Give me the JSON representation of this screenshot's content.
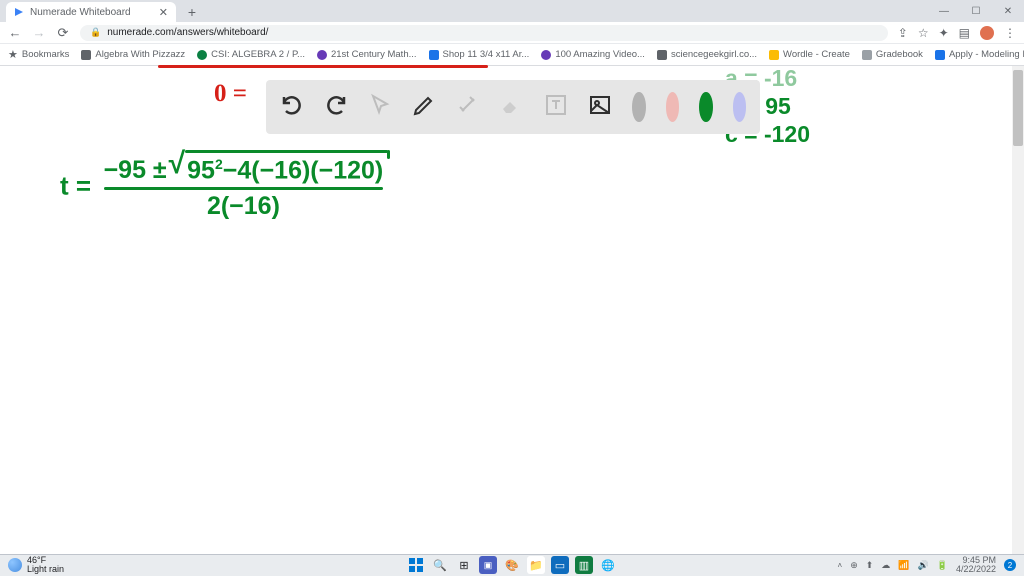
{
  "browser": {
    "tab_title": "Numerade Whiteboard",
    "url": "numerade.com/answers/whiteboard/",
    "win": {
      "min": "—",
      "max": "☐",
      "close": "✕"
    }
  },
  "bookmarks": {
    "label": "Bookmarks",
    "items": [
      {
        "label": "Algebra With Pizzazz",
        "color": "#5f6368"
      },
      {
        "label": "CSI: ALGEBRA 2 / P...",
        "color": "#0b8043"
      },
      {
        "label": "21st Century Math...",
        "color": "#673ab7"
      },
      {
        "label": "Shop 11 3/4 x11 Ar...",
        "color": "#1a73e8"
      },
      {
        "label": "100 Amazing Video...",
        "color": "#673ab7"
      },
      {
        "label": "sciencegeekgirl.co...",
        "color": "#5f6368"
      },
      {
        "label": "Wordle - Create",
        "color": "#fbbc04"
      },
      {
        "label": "Gradebook",
        "color": "#9aa0a6"
      },
      {
        "label": "Apply - Modeling I...",
        "color": "#1a73e8"
      }
    ]
  },
  "whiteboard": {
    "red_eq": "0 =",
    "coeffs": {
      "a": "a = -16",
      "b": "b = 95",
      "c": "c = -120"
    },
    "eq": {
      "lhs": "t =",
      "num_pre": "−95 ± ",
      "sqrt": "95",
      "sqrt_sup": "2",
      "sqrt_rest": "−4(−16)(−120)",
      "denom": "2(−16)"
    }
  },
  "toolbar": {
    "colors": {
      "gray": "#b2b2b2",
      "pink": "#efb9b5",
      "green": "#0a8a2a",
      "lav": "#bcbff1"
    }
  },
  "taskbar": {
    "temp": "46°F",
    "cond": "Light rain",
    "time": "9:45 PM",
    "date": "4/22/2022",
    "notif": "2"
  }
}
